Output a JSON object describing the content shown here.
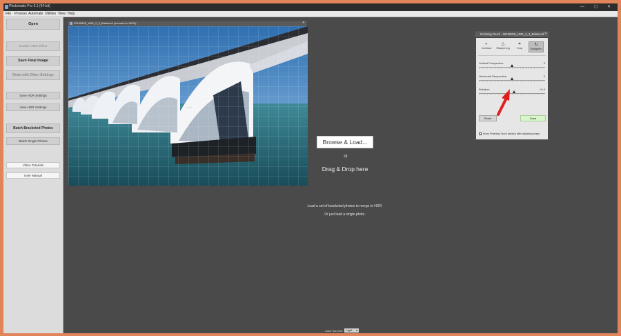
{
  "app": {
    "title": "Photomatix Pro 6.1 (64-bit)",
    "window_controls": "— ▢ ✕"
  },
  "menu": [
    "File",
    "Process",
    "Automate",
    "Utilities",
    "View",
    "Help"
  ],
  "sidebar": {
    "open": "Open",
    "double_hdr": "Double HDR Effect",
    "save_final": "Save Final Image",
    "redo_other": "Redo with Other Settings",
    "save_hdr_settings": "Save HDR Settings",
    "view_hdr_settings": "View HDR Settings",
    "batch_bracketed": "Batch Bracketed Photos",
    "batch_single": "Batch Single Photos",
    "video_tutorials": "Video Tutorials",
    "user_manual": "User Manual"
  },
  "image_window": {
    "title": "20190828_1891_2_3_Balanced (zoomed to 100%)",
    "close": "✕"
  },
  "drop": {
    "browse": "Browse & Load...",
    "or": "or",
    "drag": "Drag & Drop here",
    "hint1": "Load a set of bracketed photos to merge to HDR.",
    "hint2": "Or just load a single photo."
  },
  "color_scheme": {
    "label": "Color Scheme:",
    "value": "Light",
    "arrow": "▾"
  },
  "finishing_touch": {
    "title": "Finishing Touch - 20190828_1891_2_3_Balanced",
    "close": "✕",
    "tools": [
      {
        "label": "Contrast",
        "glyph": "◐",
        "icon": "contrast-icon"
      },
      {
        "label": "Sharpening",
        "glyph": "△",
        "icon": "sharpening-icon"
      },
      {
        "label": "Crop",
        "glyph": "⌗",
        "icon": "crop-icon"
      },
      {
        "label": "Straighten",
        "glyph": "↻",
        "icon": "straighten-icon"
      }
    ],
    "active_tool": 3,
    "sliders": [
      {
        "label": "Vertical Perspective:",
        "value": "0",
        "position": 0.5
      },
      {
        "label": "Horizontal Perspective:",
        "value": "0",
        "position": 0.5
      },
      {
        "label": "Rotation:",
        "value": "+0.3",
        "position": 0.53
      }
    ],
    "reset": "Reset",
    "done": "Done",
    "show_checkbox": "Show Finishing Touch window after adjusting image",
    "show_checkbox_checked": true,
    "check_glyph": "✓"
  },
  "colors": {
    "frame": "#e0855a",
    "workspace": "#4a4a4a",
    "done_button": "#d7f7c9",
    "annotation_arrow": "#e01e1e"
  }
}
